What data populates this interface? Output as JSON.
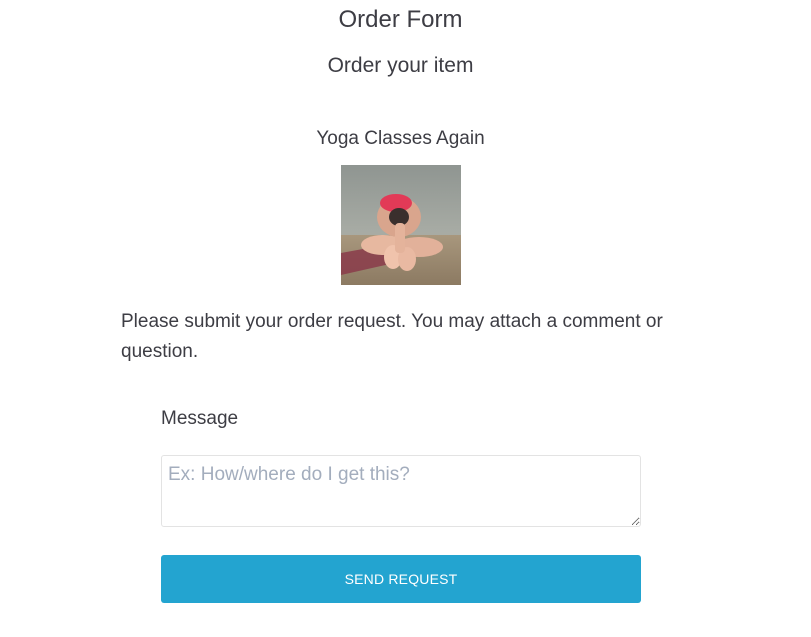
{
  "form": {
    "title": "Order Form",
    "subtitle": "Order your item"
  },
  "item": {
    "name": "Yoga Classes Again",
    "image_alt": "yoga pose photo"
  },
  "description": "Please submit your order request. You may attach a comment or question.",
  "message": {
    "label": "Message",
    "placeholder": "Ex: How/where do I get this?",
    "value": ""
  },
  "button": {
    "label": "SEND REQUEST",
    "color": "#23a4d0"
  }
}
